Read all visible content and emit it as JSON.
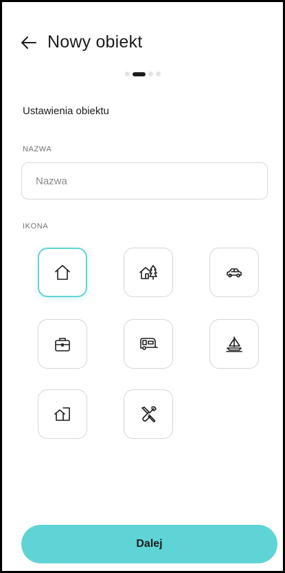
{
  "header": {
    "title": "Nowy obiekt",
    "back_icon": "arrow-left-icon"
  },
  "stepper": {
    "total_steps": 4,
    "current_step": 2
  },
  "section": {
    "title": "Ustawienia obiektu"
  },
  "name_field": {
    "label": "NAZWA",
    "placeholder": "Nazwa",
    "value": ""
  },
  "icon_field": {
    "label": "IKONA",
    "options": [
      {
        "icon": "house-icon",
        "selected": true
      },
      {
        "icon": "house-with-tree-icon",
        "selected": false
      },
      {
        "icon": "car-icon",
        "selected": false
      },
      {
        "icon": "briefcase-icon",
        "selected": false
      },
      {
        "icon": "camper-trailer-icon",
        "selected": false
      },
      {
        "icon": "sailboat-icon",
        "selected": false
      },
      {
        "icon": "house-with-door-icon",
        "selected": false
      },
      {
        "icon": "wrench-screwdriver-icon",
        "selected": false
      }
    ]
  },
  "footer": {
    "next_label": "Dalej"
  },
  "colors": {
    "accent": "#5fd4d6",
    "text": "#1c1c1c",
    "border": "#d6d6d6"
  }
}
